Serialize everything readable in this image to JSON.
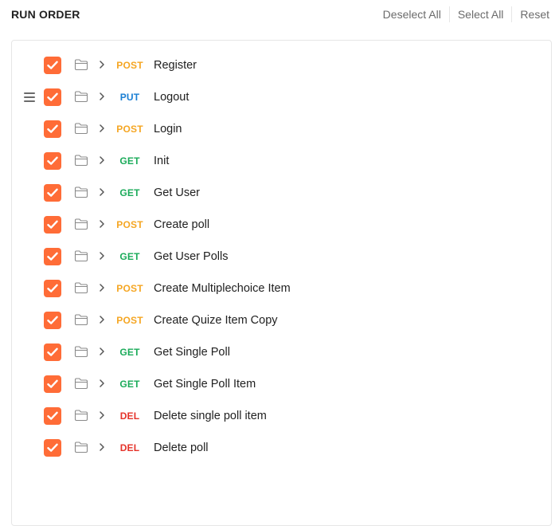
{
  "header": {
    "title": "RUN ORDER",
    "actions": {
      "deselect_all": "Deselect All",
      "select_all": "Select All",
      "reset": "Reset"
    }
  },
  "colors": {
    "checkbox": "#ff6c37",
    "POST": "#f5a623",
    "PUT": "#1a7fd4",
    "GET": "#1bab5a",
    "DEL": "#e5332a"
  },
  "requests": [
    {
      "method": "POST",
      "name": "Register",
      "checked": true
    },
    {
      "method": "PUT",
      "name": "Logout",
      "checked": true,
      "drag_handle": true
    },
    {
      "method": "POST",
      "name": "Login",
      "checked": true
    },
    {
      "method": "GET",
      "name": "Init",
      "checked": true
    },
    {
      "method": "GET",
      "name": "Get User",
      "checked": true
    },
    {
      "method": "POST",
      "name": "Create poll",
      "checked": true
    },
    {
      "method": "GET",
      "name": "Get User Polls",
      "checked": true
    },
    {
      "method": "POST",
      "name": "Create Multiplechoice Item",
      "checked": true
    },
    {
      "method": "POST",
      "name": "Create Quize Item Copy",
      "checked": true
    },
    {
      "method": "GET",
      "name": "Get Single Poll",
      "checked": true
    },
    {
      "method": "GET",
      "name": "Get Single Poll Item",
      "checked": true
    },
    {
      "method": "DEL",
      "name": "Delete single poll item",
      "checked": true
    },
    {
      "method": "DEL",
      "name": "Delete poll",
      "checked": true
    }
  ]
}
